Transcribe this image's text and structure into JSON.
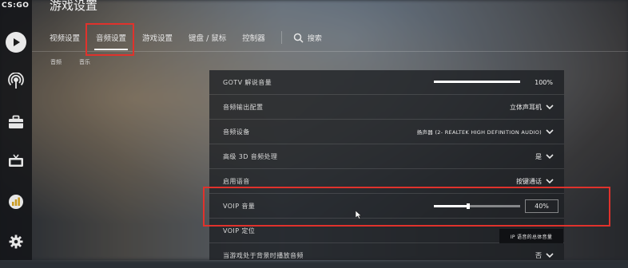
{
  "app": {
    "logo": "CS:GO",
    "title": "游戏设置"
  },
  "sidebar": {
    "items": [
      {
        "icon": "play-icon"
      },
      {
        "icon": "broadcast-icon"
      },
      {
        "icon": "briefcase-icon"
      },
      {
        "icon": "tv-icon"
      },
      {
        "icon": "stats-badge-icon"
      },
      {
        "icon": "gear-icon"
      }
    ]
  },
  "tabs": [
    {
      "label": "视频设置"
    },
    {
      "label": "音频设置",
      "active": true
    },
    {
      "label": "游戏设置"
    },
    {
      "label": "键盘 / 鼠标"
    },
    {
      "label": "控制器"
    }
  ],
  "search": {
    "label": "搜索"
  },
  "subtabs": [
    {
      "label": "音频"
    },
    {
      "label": "音乐"
    }
  ],
  "settings": [
    {
      "label": "GOTV 解说音量",
      "type": "slider",
      "value": "100%",
      "level": 1.0
    },
    {
      "label": "音频输出配置",
      "type": "select",
      "value": "立体声耳机"
    },
    {
      "label": "音频设备",
      "type": "select",
      "value": "扬声器 (2- REALTEK HIGH DEFINITION AUDIO)"
    },
    {
      "label": "高级 3D 音频处理",
      "type": "select",
      "value": "是"
    },
    {
      "label": "启用语音",
      "type": "select",
      "value": "按键通话"
    },
    {
      "label": "VOIP 音量",
      "type": "slider-box",
      "value": "40%",
      "level": 0.4
    },
    {
      "label": "VOIP 定位",
      "type": "none",
      "value": ""
    },
    {
      "label": "当游戏处于背景时播放音频",
      "type": "select",
      "value": "否"
    }
  ],
  "tooltip": {
    "text": "IP 语音的总体音量"
  },
  "colors": {
    "highlight": "#e0322c",
    "panel": "#1c1f23"
  }
}
